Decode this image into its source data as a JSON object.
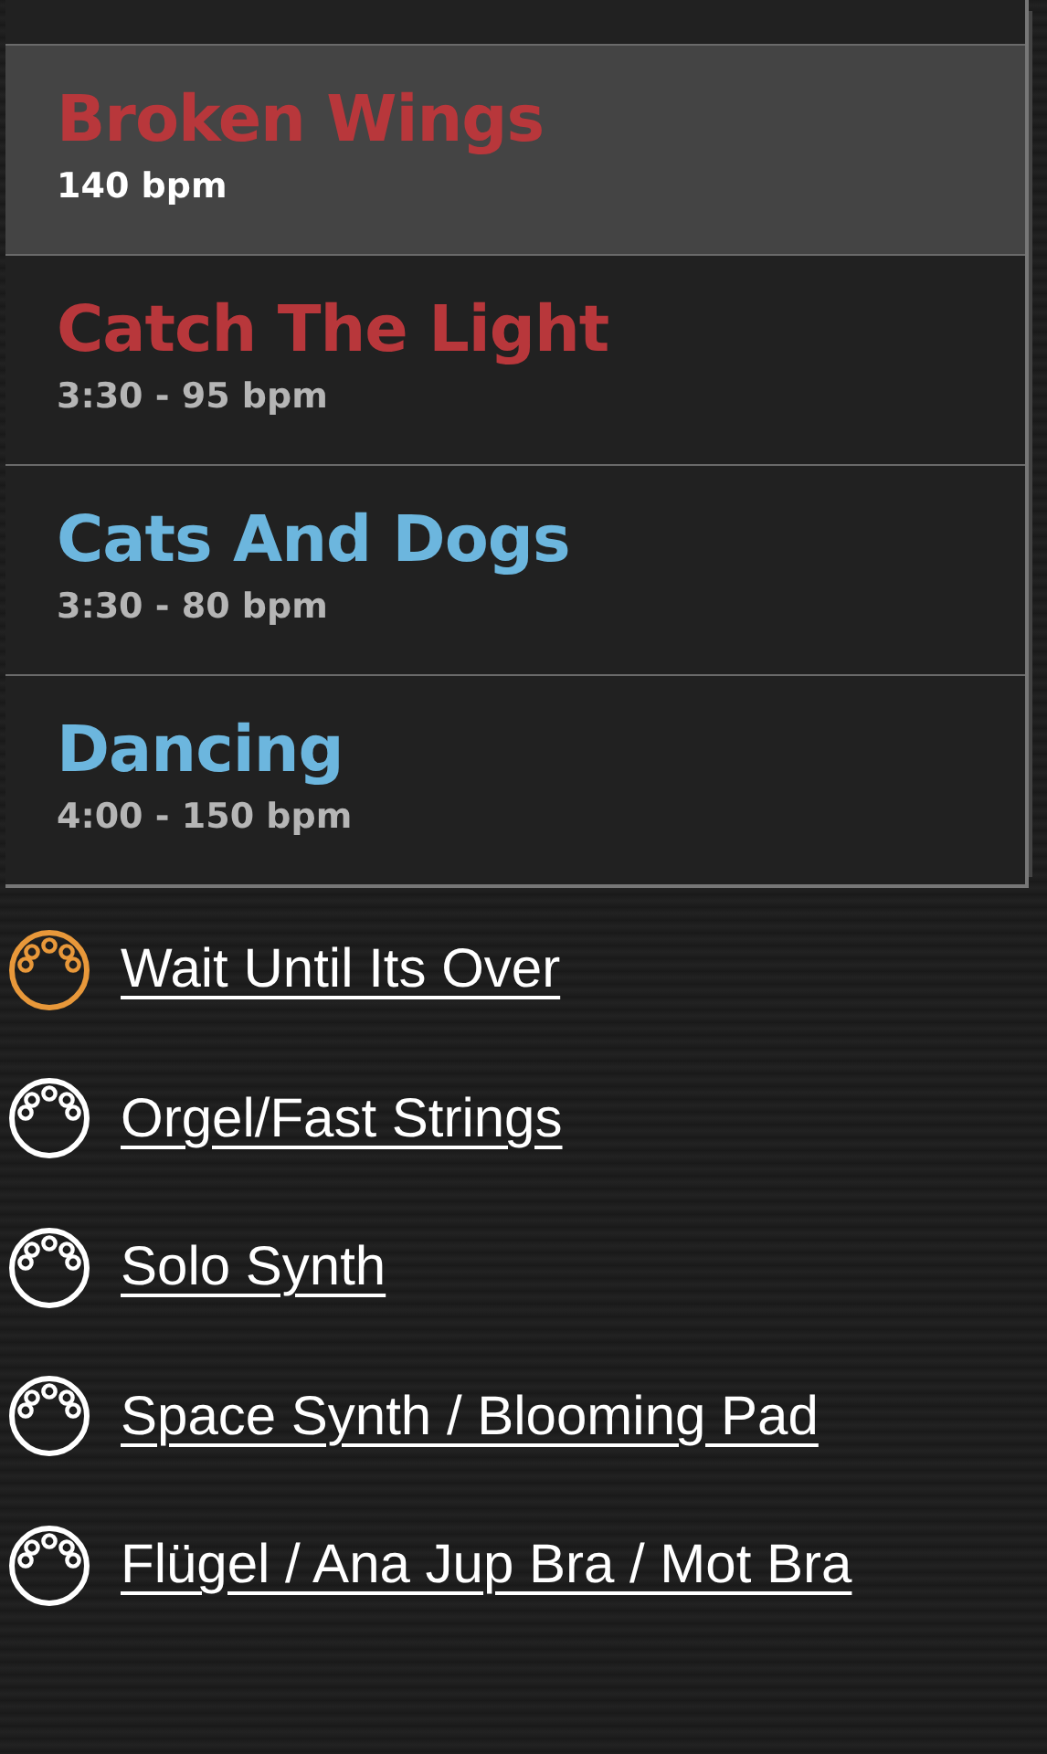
{
  "songs": [
    {
      "title": "Broken Wings",
      "detail": "140 bpm",
      "color": "#b8373b",
      "selected": true
    },
    {
      "title": "Catch The Light",
      "detail": "3:30 - 95 bpm",
      "color": "#b8373b",
      "selected": false
    },
    {
      "title": "Cats And Dogs",
      "detail": "3:30 - 80 bpm",
      "color": "#6cb6de",
      "selected": false
    },
    {
      "title": "Dancing",
      "detail": "4:00 - 150 bpm",
      "color": "#6cb6de",
      "selected": false
    }
  ],
  "patches": [
    {
      "label": "Wait Until Its Over",
      "active": true
    },
    {
      "label": "Orgel/Fast Strings",
      "active": false
    },
    {
      "label": "Solo Synth",
      "active": false
    },
    {
      "label": "Space Synth / Blooming Pad",
      "active": false
    },
    {
      "label": "Flügel / Ana Jup Bra / Mot Bra",
      "active": false
    }
  ]
}
